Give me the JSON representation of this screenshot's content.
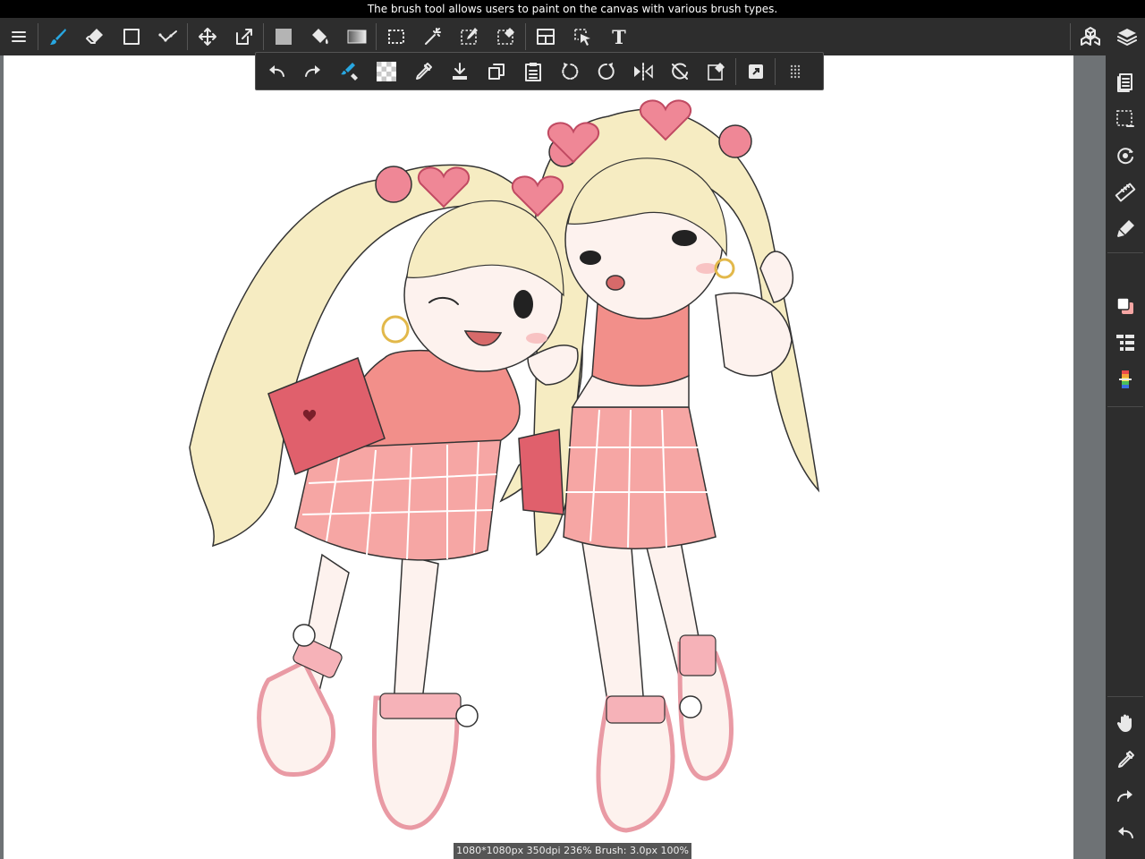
{
  "tip": {
    "text": "The brush tool allows users to paint on the canvas with various brush types."
  },
  "status": {
    "text": "1080*1080px 350dpi 236% Brush: 3.0px 100%"
  },
  "top_toolbar": {
    "tools": [
      "menu",
      "brush",
      "eraser",
      "shape",
      "correction",
      "move",
      "transform",
      "fill-color",
      "bucket",
      "gradient",
      "select-rect",
      "magic-wand",
      "select-pen",
      "select-eraser",
      "frame",
      "select-move",
      "text"
    ],
    "right_tools": [
      "3d-material",
      "layers"
    ]
  },
  "canvas": {
    "subject": "two-blonde-girls-illustration",
    "colors": {
      "hair": "#f6ecc2",
      "top": "#f28f8a",
      "skirt": "#f6a6a4",
      "bag": "#e0606c",
      "heart": "#ef8796",
      "skin": "#fdf2ee"
    }
  },
  "colors": {
    "accent": "#28a7e1",
    "toolbar_bg": "#2d2d2d",
    "canvas_bg": "#ffffff",
    "workspace_bg": "#6e7275"
  }
}
